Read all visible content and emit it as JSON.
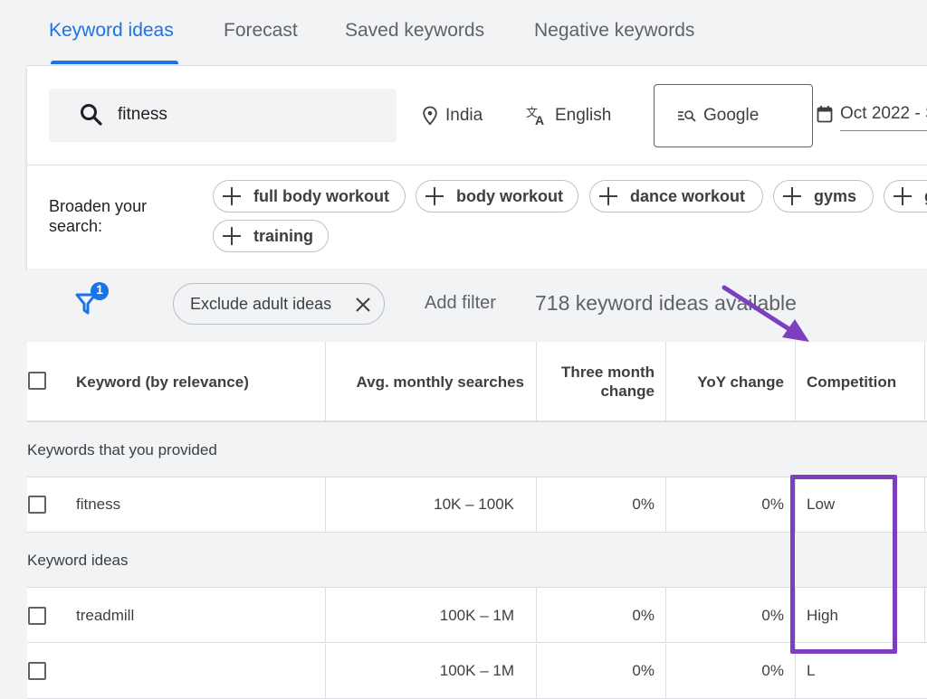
{
  "tabs": [
    {
      "label": "Keyword ideas",
      "active": true
    },
    {
      "label": "Forecast",
      "active": false
    },
    {
      "label": "Saved keywords",
      "active": false
    },
    {
      "label": "Negative keywords",
      "active": false
    }
  ],
  "search": {
    "value": "fitness",
    "icon": "search-icon"
  },
  "location": {
    "label": "India",
    "icon": "location-pin-icon"
  },
  "language": {
    "label": "English",
    "icon": "translate-icon"
  },
  "network": {
    "label": "Google",
    "icon": "search-network-icon"
  },
  "date_range": {
    "label": "Oct 2022 - S",
    "icon": "calendar-icon"
  },
  "broaden": {
    "label": "Broaden your search:",
    "chips": [
      "full body workout",
      "body workout",
      "dance workout",
      "gyms",
      "g",
      "training"
    ]
  },
  "filters": {
    "badge_count": "1",
    "exclude_chip": "Exclude adult ideas",
    "add_filter": "Add filter",
    "available_count": "718 keyword ideas available"
  },
  "table": {
    "headers": {
      "keyword": "Keyword (by relevance)",
      "avg_searches": "Avg. monthly searches",
      "three_month_1": "Three month",
      "three_month_2": "change",
      "yoy": "YoY change",
      "competition": "Competition"
    },
    "sections": [
      {
        "label": "Keywords that you provided",
        "rows": [
          {
            "keyword": "fitness",
            "avg": "10K – 100K",
            "three": "0%",
            "yoy": "0%",
            "competition": "Low"
          }
        ]
      },
      {
        "label": "Keyword ideas",
        "rows": [
          {
            "keyword": "treadmill",
            "avg": "100K – 1M",
            "three": "0%",
            "yoy": "0%",
            "competition": "High"
          },
          {
            "keyword": "",
            "avg": "100K – 1M",
            "three": "0%",
            "yoy": "0%",
            "competition": "L"
          }
        ]
      }
    ]
  },
  "colors": {
    "accent": "#1a73e8",
    "annotation": "#7e3fbf",
    "background": "#f1f3f4"
  }
}
